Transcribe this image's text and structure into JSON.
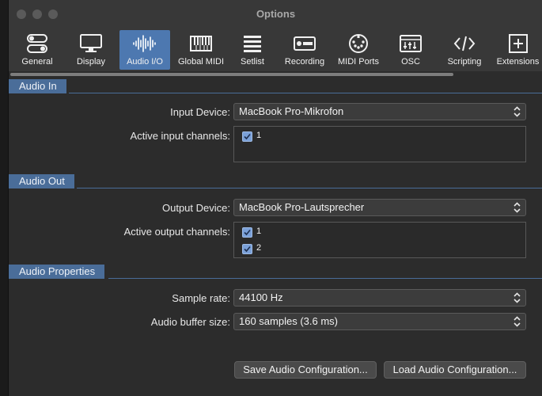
{
  "window": {
    "title": "Options"
  },
  "toolbar": {
    "tabs": [
      {
        "label": "General",
        "icon": "toggle-switches-icon"
      },
      {
        "label": "Display",
        "icon": "monitor-icon"
      },
      {
        "label": "Audio I/O",
        "icon": "waveform-icon",
        "selected": true
      },
      {
        "label": "Global MIDI",
        "icon": "keyboard-icon"
      },
      {
        "label": "Setlist",
        "icon": "list-icon"
      },
      {
        "label": "Recording",
        "icon": "rec-icon"
      },
      {
        "label": "MIDI Ports",
        "icon": "midi-port-icon"
      },
      {
        "label": "OSC",
        "icon": "osc-icon"
      },
      {
        "label": "Scripting",
        "icon": "code-icon"
      },
      {
        "label": "Extensions",
        "icon": "plus-box-icon"
      }
    ],
    "accent": "#4d78b0"
  },
  "audio_in": {
    "header": "Audio In",
    "input_device_label": "Input Device:",
    "input_device_value": "MacBook Pro-Mikrofon",
    "active_channels_label": "Active input channels:",
    "channels": [
      "1"
    ]
  },
  "audio_out": {
    "header": "Audio Out",
    "output_device_label": "Output Device:",
    "output_device_value": "MacBook Pro-Lautsprecher",
    "active_channels_label": "Active output channels:",
    "channels": [
      "1",
      "2"
    ]
  },
  "audio_properties": {
    "header": "Audio Properties",
    "sample_rate_label": "Sample rate:",
    "sample_rate_value": "44100 Hz",
    "buffer_size_label": "Audio buffer size:",
    "buffer_size_value": "160 samples (3.6 ms)"
  },
  "buttons": {
    "save": "Save Audio Configuration...",
    "load": "Load Audio Configuration..."
  },
  "colors": {
    "section_header": "#4a6d99",
    "checkbox": "#7aa0d8"
  }
}
